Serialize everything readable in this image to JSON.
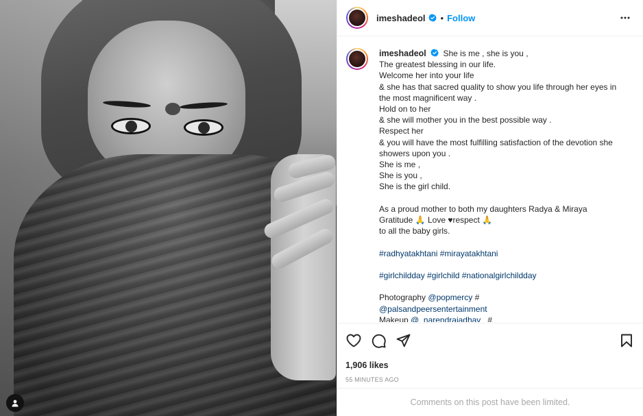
{
  "post": {
    "author": {
      "username": "imeshadeol",
      "verified": true,
      "verified_icon": "verified-badge-icon",
      "follow_label": "Follow",
      "separator": "•"
    },
    "more_icon": "more-options-icon",
    "caption": {
      "username": "imeshadeol",
      "first_line": "She is me , she is you ,",
      "lines": [
        "The greatest blessing in our life.",
        "Welcome her into your life",
        "& she has that sacred quality to show you life through her eyes in",
        "the most magnificent way .",
        "Hold on to her",
        "& she will mother you in the best possible way .",
        "Respect her",
        "& you will have the most fulfilling satisfaction of the devotion she",
        "showers upon you .",
        "She is me ,",
        "She is you ,",
        "She is the girl child.",
        "",
        "As a proud mother to both my daughters Radya & Miraya",
        "Gratitude 🙏 Love ♥respect 🙏",
        "to all the baby girls.",
        "",
        "#radhyatakhtani #mirayatakhtani",
        "",
        "#girlchildday #girlchild #nationalgirlchildday",
        "",
        "Photography @popmercy #",
        "@palsandpeersentertainment",
        "Makeup @_narendrajadhav_ #"
      ]
    },
    "actions": {
      "like_icon": "heart-icon",
      "comment_icon": "comment-icon",
      "share_icon": "share-icon",
      "save_icon": "bookmark-icon"
    },
    "likes": "1,906 likes",
    "timestamp": "55 MINUTES AGO",
    "comments_notice": "Comments on this post have been limited.",
    "media": {
      "description_icon": "user-tag-icon"
    }
  },
  "colors": {
    "accent": "#0095f6",
    "hashtag": "#00376b",
    "muted": "#8e8e8e",
    "text": "#262626"
  }
}
